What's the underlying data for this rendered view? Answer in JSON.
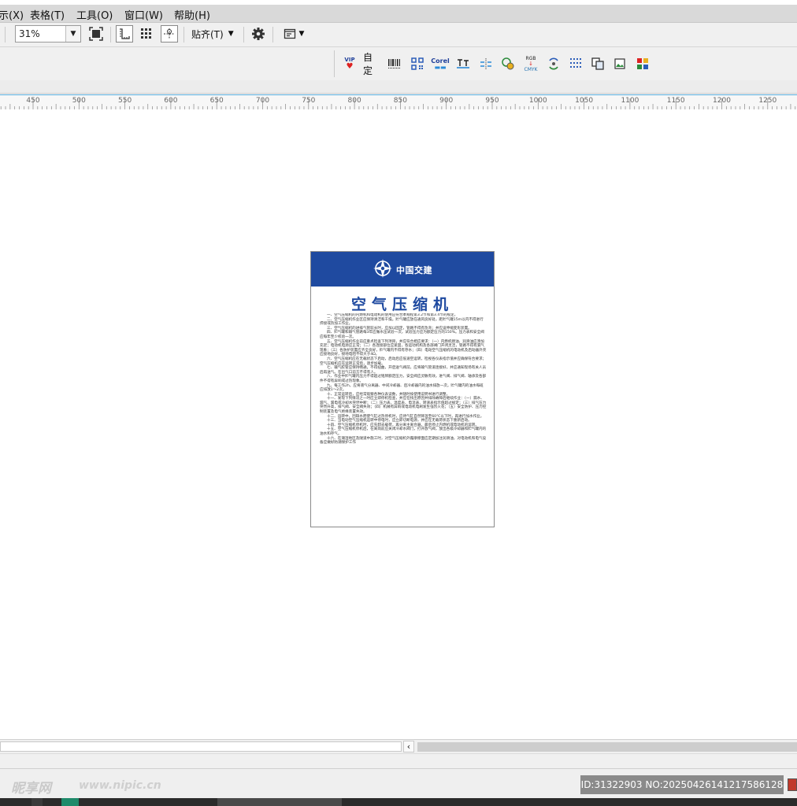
{
  "menu": {
    "items": [
      "示(X)",
      "表格(T)",
      "工具(O)",
      "窗口(W)",
      "帮助(H)"
    ]
  },
  "toolbar": {
    "zoom_value": "31%",
    "snap_label": "贴齐(T)",
    "settings_icon": "gear-icon"
  },
  "toolbar2": {
    "vip_label": "VIP",
    "custom_label": "自定",
    "corel_label": "Corel",
    "rgb_label": "RGB",
    "cmyk_label": "CMYK"
  },
  "ruler": {
    "labels": [
      "450",
      "500",
      "550",
      "600",
      "650",
      "700",
      "750",
      "800",
      "850",
      "900",
      "950",
      "1000",
      "1050",
      "1100",
      "1150",
      "1200",
      "1250"
    ]
  },
  "document": {
    "brand": "中国交建",
    "title": "空气压缩机",
    "paragraphs": [
      "一、空气压缩机的内燃机和电动机的使用应符合本规程第3.2节和第3.4节的规定。",
      "二、空气压缩机作业区应保持清洁和干燥。贮气罐应放在通风良好处，距贮气罐15m以内不得进行焊接或热加工作业。",
      "三、空气压缩机的进排气管较长时，应加以固定，管路不得有急弯；并应设伸缩变形装置。",
      "四、贮气罐和输气管路每3年应做水压试验一次，试验压力应为额定压力的150%。压力表和安全阀应每年至少校验一次。",
      "五、空气压缩机作业前应重点检查下列项目，并应符合相应要求：（一）内燃机燃油、润滑油应添加充足；电动机电源应正常；（二）各连接部位应紧固，各运动机构及各部阀门开闭灵活，管路不得有漏气现象；（三）各防护装置应齐全良好，贮气罐内不得有存水；（四）电动空气压缩机的电动机及启动器外壳应接地良好，接地电阻不得大于4Ω。",
      "六、空气压缩机应在无载状态下启动，启动后应低速空运转，检视各仪表指示值并应确保符合要求；空气压缩机应在运转正常后，逐步加载。",
      "七、输气胶管应保持畅通，不得扭曲，开启送气阀前，应将输气管道连接好，并应通知现场有关人员后再送气。在出气口前方不得有人。",
      "八、作业中贮气罐内压力不得超过铭牌额定压力，安全阀应灵敏有效。进气阀、排气阀、轴承及各部件不得有异响或过热现象。",
      "九、每工作2h，应将液气分离器、中间冷却器、后冷却器内的油水排放一次。贮气罐内的油水每班应排放1～2次。",
      "十、正常运转后，应经常观察各种仪表读数，并随时按使用说明书进行调整。",
      "十一、发现下列情况之一时应立即停机检查，并应在找出原因并排除故障后继续作业：（一）漏水、漏气、漏电或冷却水突然中断；（二）压力表、温度表、电流表、转速表指示值超过规定；（三）排气压力突然升高，排气阀、安全阀失效；（四）机械有异响或电动机电刷发生强烈火花；（五）安全防护、压力控制装置及电气绝缘装置失效。",
      "十二、运转中，因缺水而使气缸过热停机时，应待气缸自然降温至60℃以下时，再进行加水作业。",
      "十三、当电动空气压缩机运转中停电时，应立即切断电源，并应在无载荷状态下重新启动。",
      "十四、空气压缩机停机时，应先卸去载荷，再分离主离合器，最后停止内燃机或电动机的运转。",
      "十五、空气压缩机停机后，在离岗前应关闭冷却水阀门，打开放气阀，放出各级冷却器和贮气罐内的油水和存气。",
      "十六、在潮湿地区及隧道中施工时，对空气压缩机外露摩擦面应定期加注润滑油，对电动机和电气设备应做好防潮保护工作"
    ]
  },
  "status": {
    "watermark": "昵享网",
    "watermark_url": "www.nipic.cn",
    "id_text": "ID:31322903 NO:20250426141217586128"
  }
}
